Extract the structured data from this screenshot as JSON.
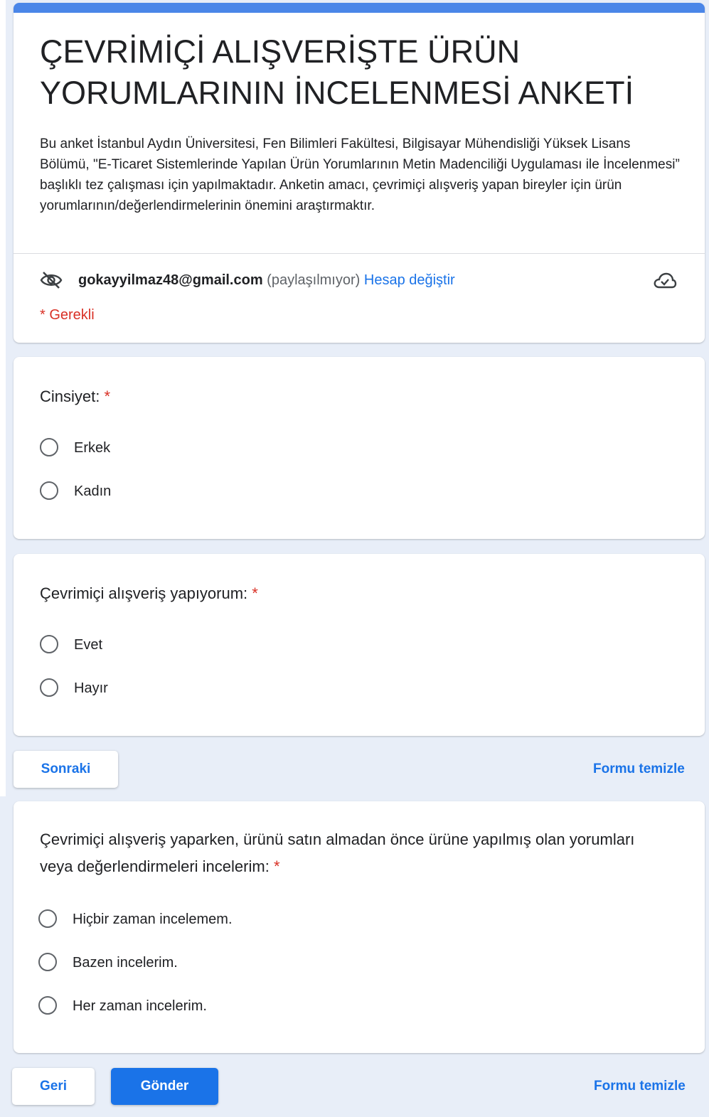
{
  "header": {
    "title": "ÇEVRİMİÇİ ALIŞVERİŞTE ÜRÜN YORUMLARININ İNCELENMESİ ANKETİ",
    "description": "Bu anket İstanbul Aydın Üniversitesi, Fen Bilimleri Fakültesi, Bilgisayar Mühendisliği Yüksek Lisans Bölümü, \"E-Ticaret Sistemlerinde Yapılan Ürün Yorumlarının Metin Madenciliği Uygulaması ile İncelenmesi” başlıklı tez çalışması için yapılmaktadır. Anketin amacı, çevrimiçi alışveriş yapan bireyler için ürün yorumlarının/değerlendirmelerinin önemini araştırmaktır.",
    "account": {
      "email": "gokayyilmaz48@gmail.com",
      "shared_status": "(paylaşılmıyor)",
      "switch_label": "Hesap değiştir",
      "eye_icon": "eye-off-icon",
      "cloud_icon": "cloud-done-icon"
    },
    "required_note": "* Gerekli"
  },
  "questions": [
    {
      "title": "Cinsiyet:",
      "required_mark": "*",
      "options": [
        "Erkek",
        "Kadın"
      ]
    },
    {
      "title": "Çevrimiçi alışveriş yapıyorum:",
      "required_mark": "*",
      "options": [
        "Evet",
        "Hayır"
      ]
    },
    {
      "title": "Çevrimiçi alışveriş yaparken, ürünü satın almadan önce ürüne yapılmış olan yorumları veya değerlendirmeleri incelerim:",
      "required_mark": "*",
      "options": [
        "Hiçbir zaman incelemem.",
        "Bazen incelerim.",
        "Her zaman incelerim."
      ]
    }
  ],
  "nav1": {
    "next_label": "Sonraki",
    "clear_label": "Formu temizle"
  },
  "nav2": {
    "back_label": "Geri",
    "submit_label": "Gönder",
    "clear_label": "Formu temizle"
  },
  "colors": {
    "accent": "#4a86e8",
    "link": "#1a73e8",
    "required": "#d93025",
    "background": "#e8eef8"
  }
}
